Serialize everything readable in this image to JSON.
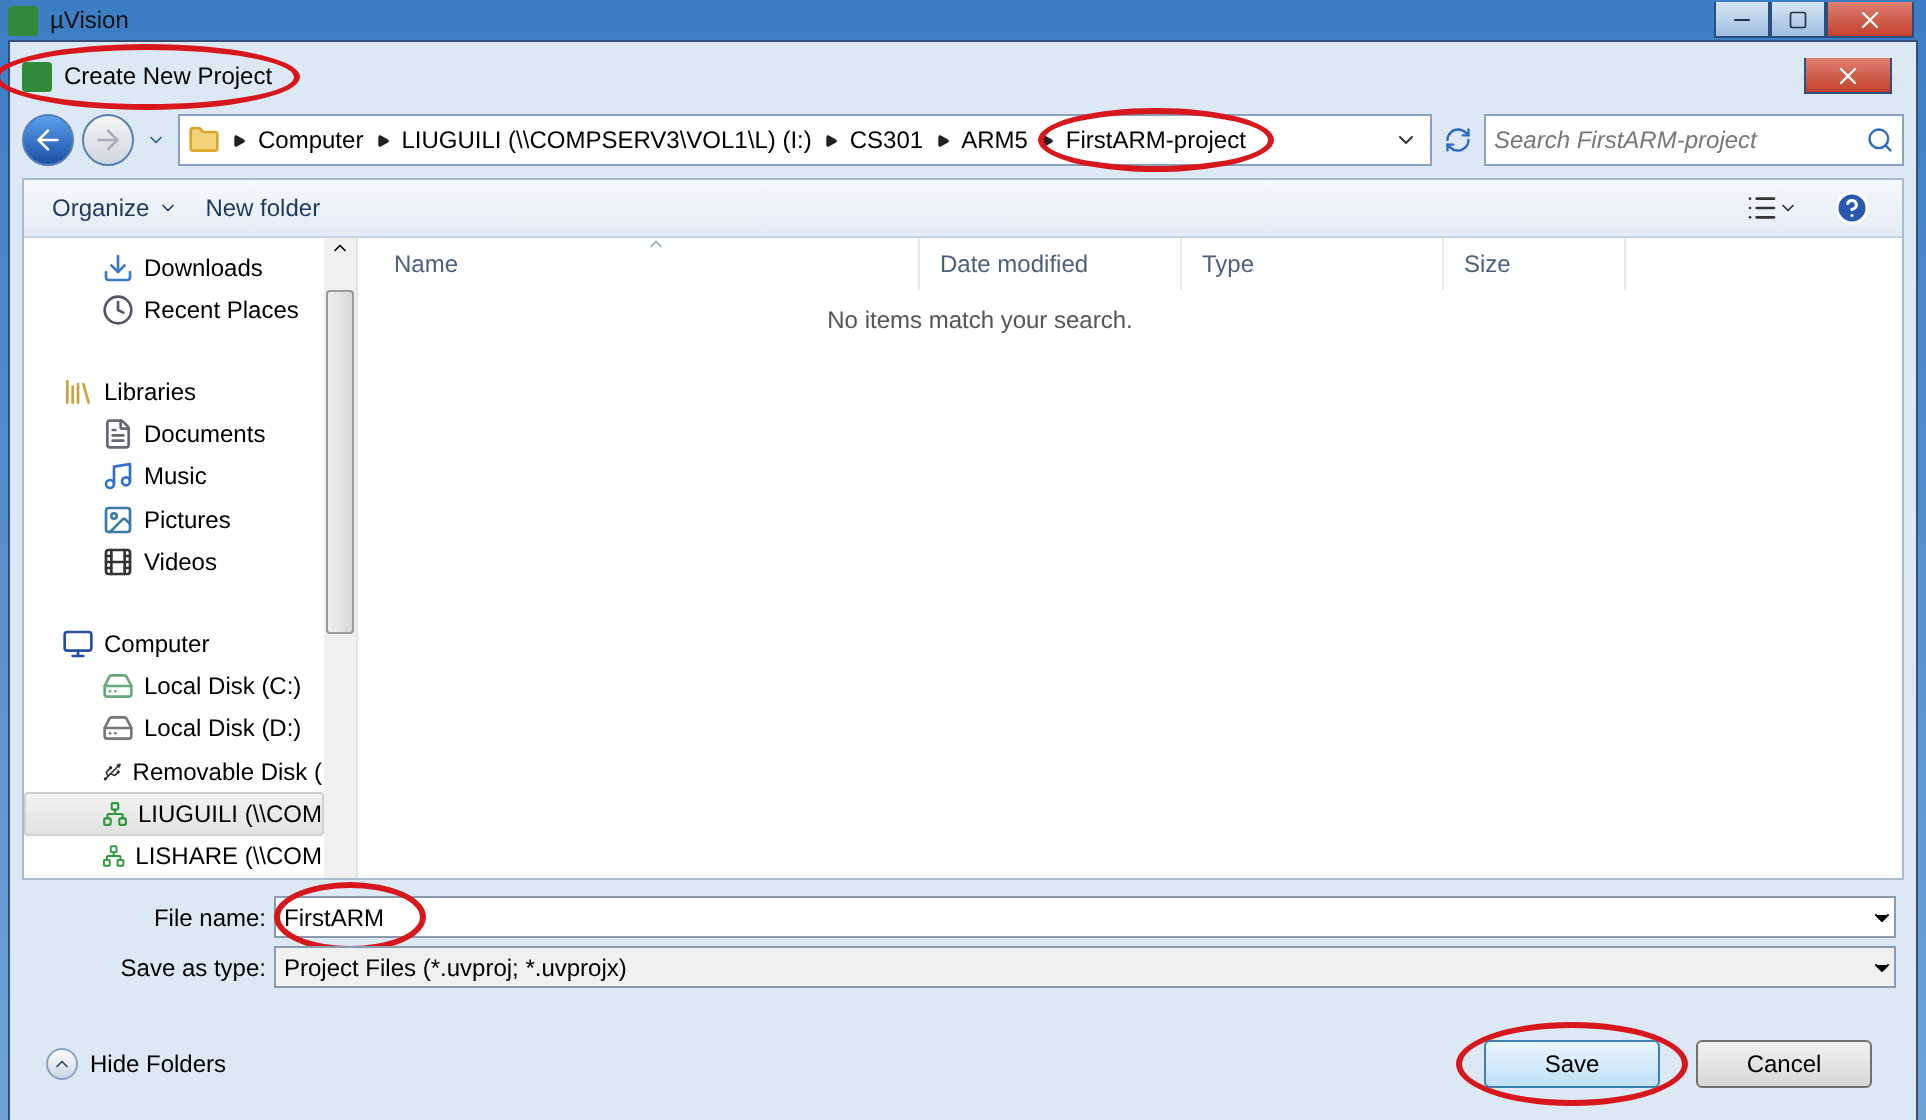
{
  "app_window": {
    "title": "µVision"
  },
  "dialog": {
    "title": "Create New Project",
    "title_annotated": true
  },
  "address": {
    "crumbs": [
      {
        "label": "Computer",
        "annotated": false
      },
      {
        "label": "LIUGUILI (\\\\COMPSERV3\\VOL1\\L) (I:)",
        "annotated": false
      },
      {
        "label": "CS301",
        "annotated": false
      },
      {
        "label": "ARM5",
        "annotated": false
      },
      {
        "label": "FirstARM-project",
        "annotated": true
      }
    ],
    "search_placeholder": "Search FirstARM-project"
  },
  "toolbar": {
    "organize": "Organize",
    "new_folder": "New folder"
  },
  "nav": [
    {
      "children": [
        {
          "label": "Downloads",
          "kind": "downloads",
          "selected": false
        },
        {
          "label": "Recent Places",
          "kind": "recent",
          "selected": false
        }
      ]
    },
    {
      "label": "Libraries",
      "kind": "library",
      "children": [
        {
          "label": "Documents",
          "kind": "document",
          "selected": false
        },
        {
          "label": "Music",
          "kind": "music",
          "selected": false
        },
        {
          "label": "Pictures",
          "kind": "pictures",
          "selected": false
        },
        {
          "label": "Videos",
          "kind": "video",
          "selected": false
        }
      ]
    },
    {
      "label": "Computer",
      "kind": "computer",
      "children": [
        {
          "label": "Local Disk (C:)",
          "kind": "system-disk",
          "selected": false
        },
        {
          "label": "Local Disk (D:)",
          "kind": "disk",
          "selected": false
        },
        {
          "label": "Removable Disk (",
          "kind": "removable",
          "selected": false
        },
        {
          "label": "LIUGUILI (\\\\COM",
          "kind": "network",
          "selected": true
        },
        {
          "label": "LISHARE (\\\\COM",
          "kind": "network",
          "selected": false
        }
      ]
    }
  ],
  "columns": [
    {
      "label": "Name",
      "sorted": true
    },
    {
      "label": "Date modified",
      "sorted": false
    },
    {
      "label": "Type",
      "sorted": false
    },
    {
      "label": "Size",
      "sorted": false
    }
  ],
  "empty_message": "No items match your search.",
  "file_name": {
    "label": "File name:",
    "value": "FirstARM",
    "annotated": true
  },
  "save_type": {
    "label": "Save as type:",
    "value": "Project Files (*.uvproj; *.uvprojx)"
  },
  "hide_folders": "Hide Folders",
  "buttons": [
    {
      "label": "Save",
      "default": true,
      "annotated": true
    },
    {
      "label": "Cancel",
      "default": false,
      "annotated": false
    }
  ]
}
